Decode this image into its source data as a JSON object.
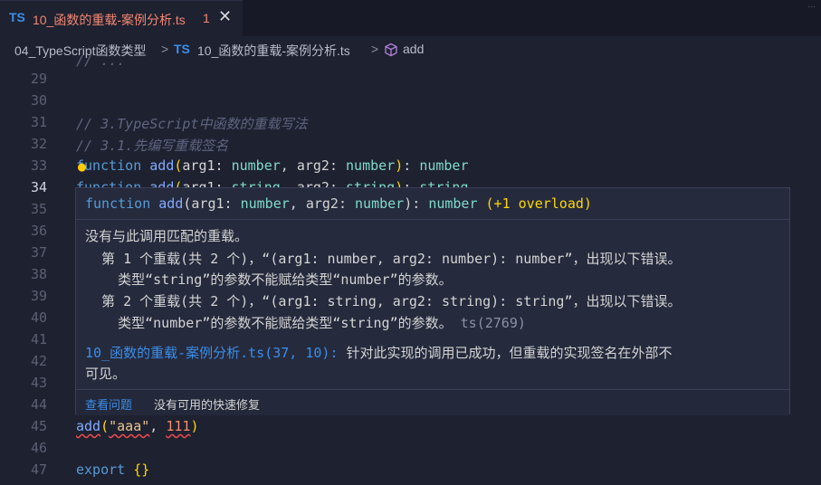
{
  "tab": {
    "lang_badge": "TS",
    "title": "10_函数的重载-案例分析.ts",
    "problems": "1",
    "close": "✕"
  },
  "topright": {
    "text": "..."
  },
  "breadcrumb": {
    "folder": "04_TypeScript函数类型",
    "lang_badge": "TS",
    "file": "10_函数的重载-案例分析.ts",
    "symbol": "add"
  },
  "gutter": {
    "lines": [
      "29",
      "30",
      "31",
      "32",
      "33",
      "34",
      "35",
      "36",
      "37",
      "38",
      "39",
      "40",
      "41",
      "42",
      "43",
      "44",
      "45",
      "46",
      "47"
    ],
    "current": "34"
  },
  "code": {
    "line28_partial": "// ...",
    "comment31": "// 3.TypeScript中函数的重载写法",
    "comment32": "// 3.1.先编写重载签名",
    "l33": {
      "kw": "function",
      "fn": "add",
      "p1": "arg1",
      "t1": "number",
      "p2": "arg2",
      "t2": "number",
      "ret": "number"
    },
    "l34": {
      "kw": "function",
      "fn": "add",
      "p1": "arg1",
      "t1": "string",
      "p2": "arg2",
      "t2": "string",
      "ret": "string"
    },
    "l45": {
      "fn": "add",
      "s": "\"aaa\"",
      "n": "111"
    },
    "l47": {
      "kw": "export",
      "obj": "{}"
    }
  },
  "hover": {
    "signature": {
      "kw": "function",
      "fn": "add",
      "p1": "arg1",
      "t1": "number",
      "p2": "arg2",
      "t2": "number",
      "ret": "number",
      "overload": "(+1 overload)"
    },
    "msg1": "没有与此调用匹配的重载。",
    "msg2": "  第 1 个重载(共 2 个)，“(arg1: number, arg2: number): number”，出现以下错误。",
    "msg3": "    类型“string”的参数不能赋给类型“number”的参数。",
    "msg4": "  第 2 个重载(共 2 个)，“(arg1: string, arg2: string): string”，出现以下错误。",
    "msg5": "    类型“number”的参数不能赋给类型“string”的参数。",
    "msg5_code": "ts(2769)",
    "related_link": "10_函数的重载-案例分析.ts(37, 10):",
    "related_text": " 针对此实现的调用已成功，但重载的实现签名在外部不",
    "related_text2": "可见。",
    "view_problem": "查看问题",
    "no_fix": "没有可用的快速修复"
  }
}
